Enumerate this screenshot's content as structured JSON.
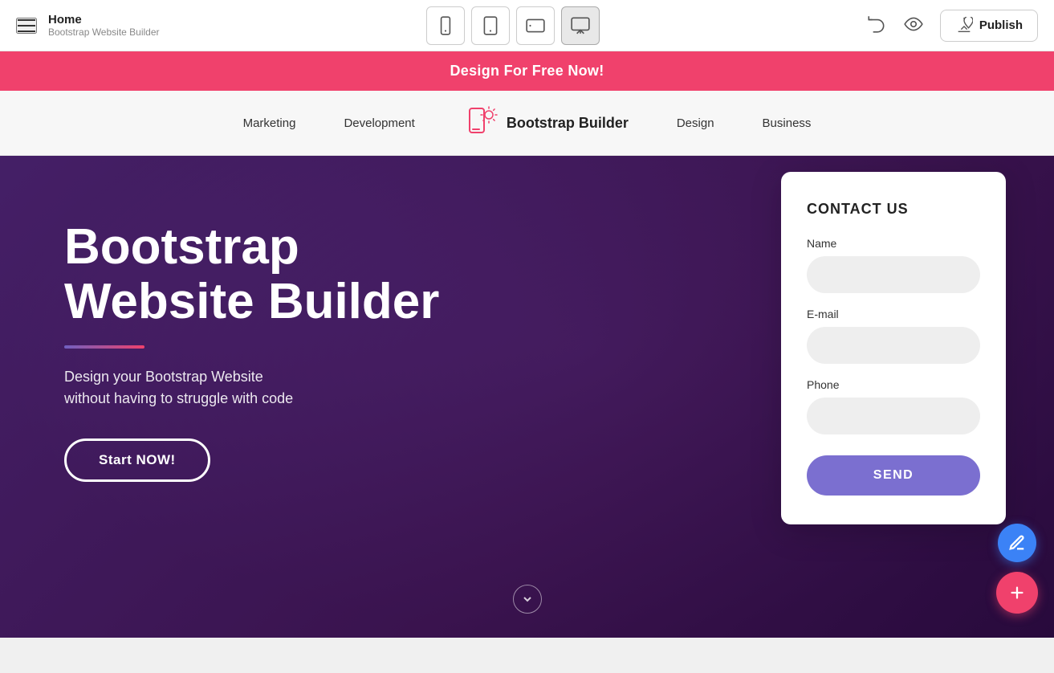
{
  "topbar": {
    "home_label": "Home",
    "subtitle": "Bootstrap Website Builder",
    "publish_label": "Publish",
    "devices": [
      {
        "id": "mobile",
        "label": "Mobile"
      },
      {
        "id": "tablet",
        "label": "Tablet"
      },
      {
        "id": "tablet-landscape",
        "label": "Tablet Landscape"
      },
      {
        "id": "desktop",
        "label": "Desktop"
      }
    ]
  },
  "banner": {
    "text": "Design For Free Now!"
  },
  "nav": {
    "items_left": [
      {
        "label": "Marketing"
      },
      {
        "label": "Development"
      }
    ],
    "logo_text": "Bootstrap Builder",
    "items_right": [
      {
        "label": "Design"
      },
      {
        "label": "Business"
      }
    ]
  },
  "hero": {
    "title": "Bootstrap\nWebsite Builder",
    "subtitle": "Design your Bootstrap Website\nwithout having to struggle with code",
    "cta_label": "Start NOW!"
  },
  "contact": {
    "title": "CONTACT US",
    "name_label": "Name",
    "name_placeholder": "",
    "email_label": "E-mail",
    "email_placeholder": "",
    "phone_label": "Phone",
    "phone_placeholder": "",
    "send_label": "SEND"
  }
}
